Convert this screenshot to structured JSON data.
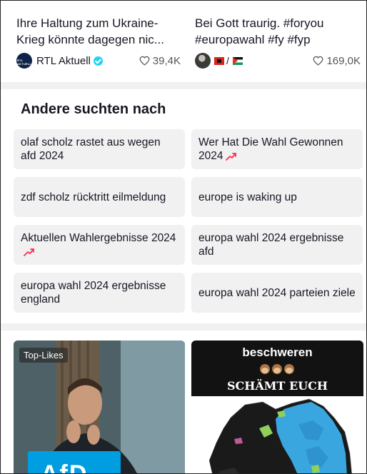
{
  "top_cards": [
    {
      "title": "Ihre Haltung zum Ukraine-Krieg könnte dagegen nic...",
      "author": "RTL Aktuell",
      "avatar_text": "RTL AKTUELL",
      "verified": true,
      "likes": "39,4K"
    },
    {
      "title": "Bei Gott traurig. #foryou #europawahl #fy #fyp",
      "author_separator": "/",
      "likes": "169,0K"
    }
  ],
  "section_title": "Andere suchten nach",
  "suggestions": [
    {
      "text": "olaf scholz rastet aus wegen afd 2024",
      "trending": false
    },
    {
      "text": "Wer Hat Die Wahl Gewonnen 2024",
      "trending": true
    },
    {
      "text": "zdf scholz rücktritt eilmeldung",
      "trending": false
    },
    {
      "text": "europe is waking up",
      "trending": false
    },
    {
      "text": "Aktuellen Wahlergebnisse 2024",
      "trending": true
    },
    {
      "text": "europa wahl 2024 ergebnisse afd",
      "trending": false
    },
    {
      "text": "europa wahl 2024 ergebnisse england",
      "trending": false
    },
    {
      "text": "europa wahl 2024 parteien ziele",
      "trending": false
    }
  ],
  "videos": [
    {
      "badge": "Top-Likes",
      "sign_text": "AfD"
    },
    {
      "line1": "beschweren",
      "line2": "SCHÄMT EUCH"
    }
  ],
  "colors": {
    "trend": "#fe2c55",
    "chip_bg": "#f1f1f2",
    "afd_blue": "#009ee0",
    "verified": "#20d5ec"
  },
  "icons": [
    "heart-outline-icon",
    "verified-badge-icon",
    "trending-arrow-icon",
    "albania-flag-icon",
    "palestine-flag-icon"
  ]
}
